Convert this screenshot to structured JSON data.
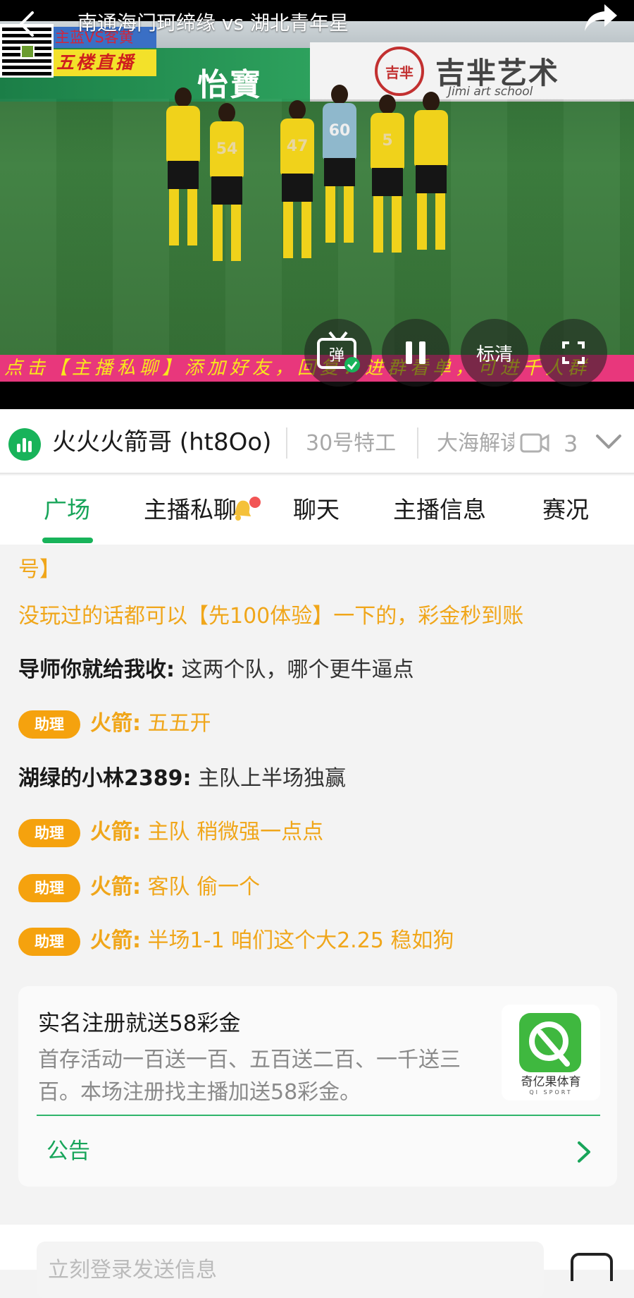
{
  "video": {
    "title": "南通海门珂缔缘 vs 湖北青年星",
    "overlay_match": "主蓝VS客黄",
    "overlay_live": "五楼直播",
    "ticker": "点击【主播私聊】添加好友，回复：进群看单，可进千人群",
    "board_brand_green": "怡寶",
    "board_brand_cn": "吉芈艺术",
    "board_brand_en": "Jimi art school",
    "board_logo": "吉芈",
    "danmaku_label": "弹",
    "quality_label": "标清",
    "players": [
      {
        "number": "54",
        "gk": false
      },
      {
        "number": "",
        "gk": false
      },
      {
        "number": "47",
        "gk": false
      },
      {
        "number": "60",
        "gk": true
      },
      {
        "number": "5",
        "gk": false
      },
      {
        "number": "",
        "gk": false
      }
    ]
  },
  "anchors": {
    "current": "火火火箭哥 (ht8Oo)",
    "others": [
      "30号特工",
      "大海解读"
    ],
    "count": "3"
  },
  "tabs": [
    {
      "label": "广场",
      "active": true
    },
    {
      "label": "主播私聊",
      "active": false,
      "has_badge": true
    },
    {
      "label": "聊天",
      "active": false
    },
    {
      "label": "主播信息",
      "active": false
    },
    {
      "label": "赛况",
      "active": false
    }
  ],
  "chat": {
    "messages": [
      {
        "type": "promo",
        "text": "号】"
      },
      {
        "type": "promo",
        "text": "没玩过的话都可以【先100体验】一下的，彩金秒到账"
      },
      {
        "type": "user",
        "user": "导师你就给我收:",
        "text": " 这两个队，哪个更牛逼点"
      },
      {
        "type": "assist",
        "badge": "助理",
        "user": "火箭:",
        "text": " 五五开"
      },
      {
        "type": "user",
        "user": "湖绿的小林2389:",
        "text": " 主队上半场独赢"
      },
      {
        "type": "assist",
        "badge": "助理",
        "user": "火箭:",
        "text": " 主队 稍微强一点点"
      },
      {
        "type": "assist",
        "badge": "助理",
        "user": "火箭:",
        "text": " 客队 偷一个"
      },
      {
        "type": "assist",
        "badge": "助理",
        "user": "火箭:",
        "text": " 半场1-1   咱们这个大2.25  稳如狗"
      }
    ]
  },
  "notice": {
    "title": "实名注册就送58彩金",
    "description": "首存活动一百送一百、五百送二百、一千送三百。本场注册找主播加送58彩金。",
    "app_name": "奇亿果体育",
    "app_en": "QI SPORT",
    "link_label": "公告"
  },
  "input": {
    "placeholder": "立刻登录发送信息"
  },
  "colors": {
    "accent_green": "#18b35a",
    "assist_orange": "#f5a20e",
    "promo_orange": "#f0a61a",
    "ticker_bg": "#e8377c"
  }
}
